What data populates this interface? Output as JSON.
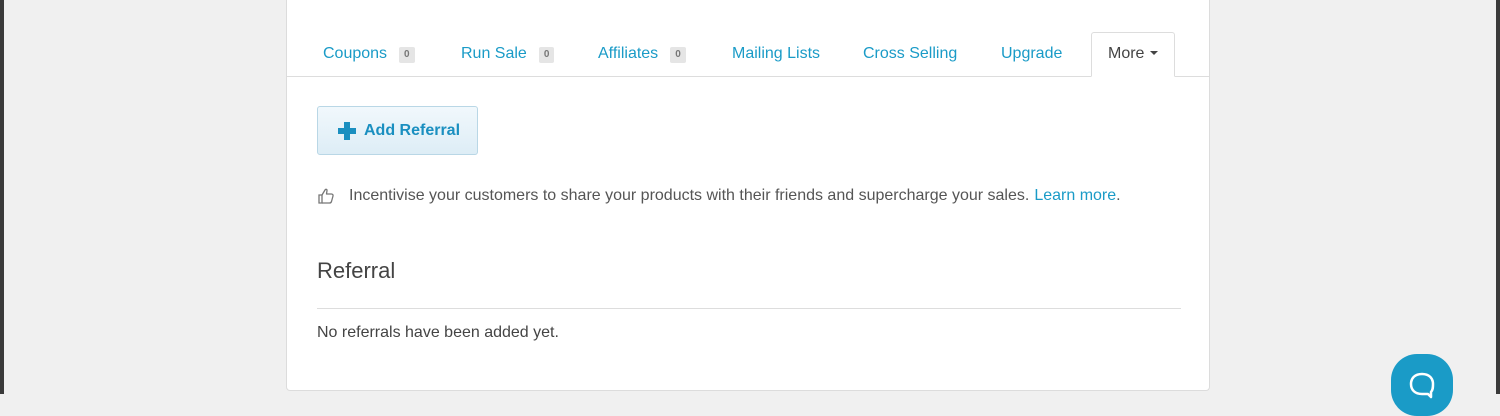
{
  "tabs": [
    {
      "label": "Coupons",
      "count": "0"
    },
    {
      "label": "Run Sale",
      "count": "0"
    },
    {
      "label": "Affiliates",
      "count": "0"
    },
    {
      "label": "Mailing Lists"
    },
    {
      "label": "Cross Selling"
    },
    {
      "label": "Upgrade"
    },
    {
      "label": "More",
      "active": true
    }
  ],
  "actions": {
    "add_referral_label": "Add Referral"
  },
  "info": {
    "text": "Incentivise your customers to share your products with their friends and supercharge your sales.",
    "link_label": "Learn more",
    "link_suffix": "."
  },
  "section": {
    "title": "Referral",
    "empty_message": "No referrals have been added yet."
  },
  "icons": {
    "add": "plus-icon",
    "info": "thumbs-up-icon",
    "more": "caret-down-icon",
    "chat": "chat-bubble-icon"
  },
  "colors": {
    "accent": "#1a9bc7",
    "button_bg": "#e8f3f9",
    "text": "#444444"
  }
}
